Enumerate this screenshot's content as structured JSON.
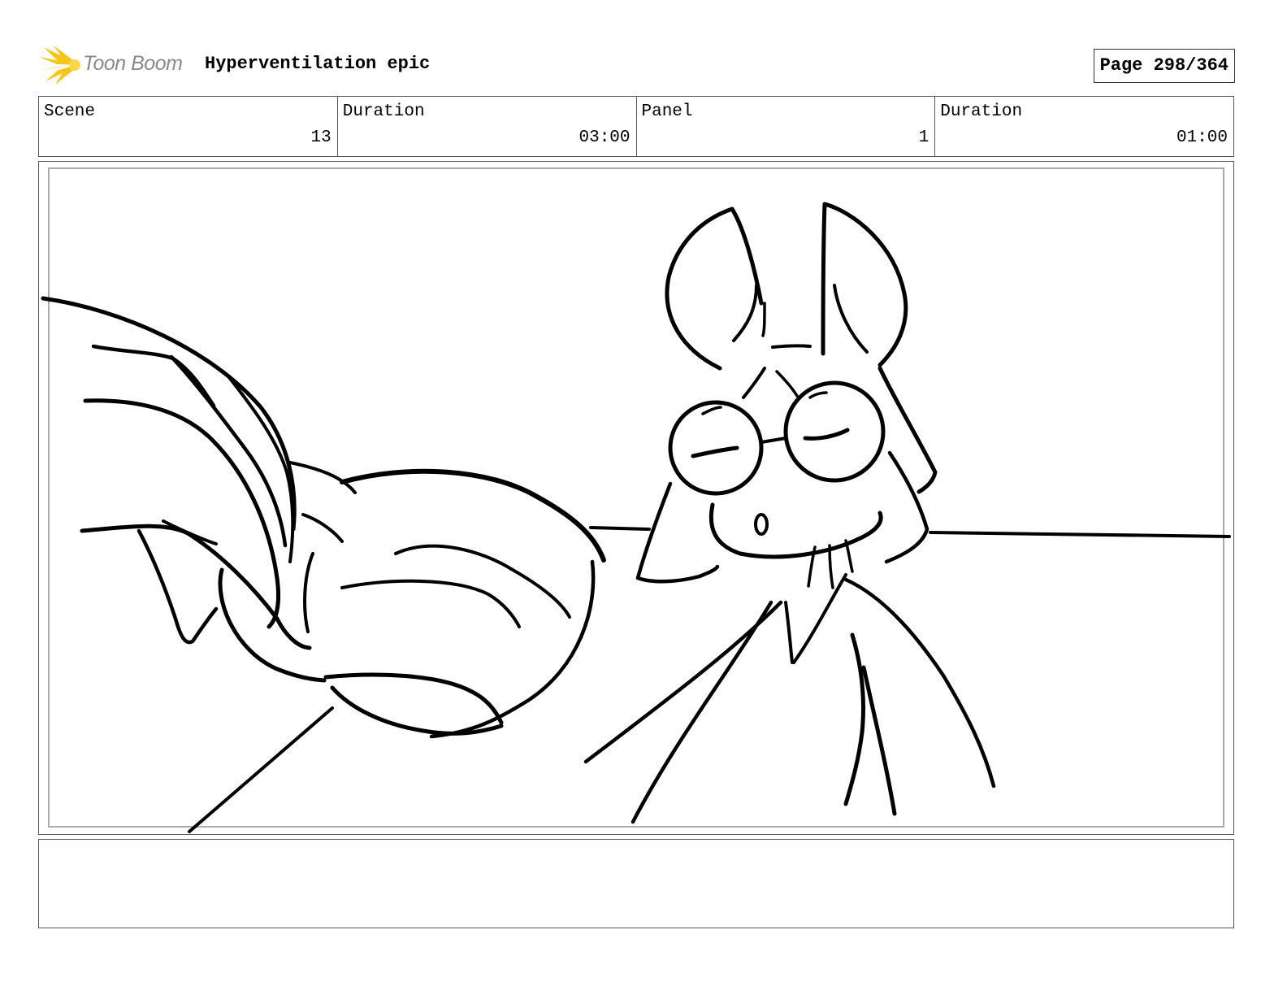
{
  "header": {
    "logo_text": "Toon Boom",
    "project_title": "Hyperventilation epic",
    "page_label": "Page 298/364"
  },
  "info": {
    "scene_label": "Scene",
    "scene_value": "13",
    "scene_duration_label": "Duration",
    "scene_duration_value": "03:00",
    "panel_label": "Panel",
    "panel_value": "1",
    "panel_duration_label": "Duration",
    "panel_duration_value": "01:00"
  },
  "notes": {
    "text": ""
  },
  "colors": {
    "logo_accent": "#f5c518",
    "logo_text": "#8a8a8a",
    "border": "#555555",
    "inner_border": "#aaaaaa"
  }
}
